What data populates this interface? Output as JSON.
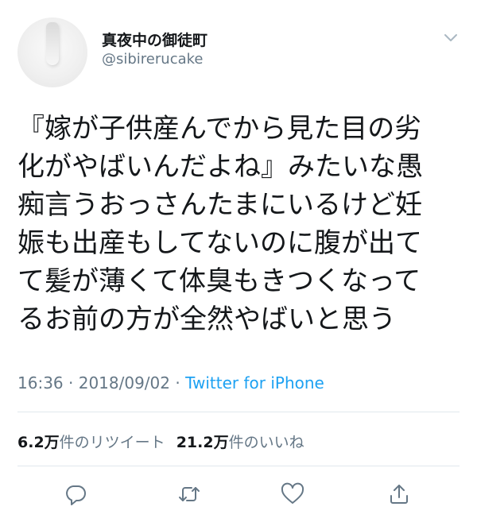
{
  "author": {
    "display_name": "真夜中の御徒町",
    "handle": "@sibirerucake",
    "avatar_icon": "avatar-image"
  },
  "menu_icon": "chevron-down-icon",
  "tweet": {
    "lines": [
      "『嫁が子供産んでから見た目の劣",
      "化がやばいんだよね』みたいな愚",
      "痴言うおっさんたまにいるけど妊",
      "娠も出産もしてないのに腹が出て",
      "て髪が薄くて体臭もきつくなって",
      "るお前の方が全然やばいと思う"
    ]
  },
  "meta": {
    "time": "16:36",
    "separator1": " · ",
    "date": "2018/09/02",
    "separator2": " · ",
    "source": "Twitter for iPhone"
  },
  "stats": {
    "retweets_count": "6.2万",
    "retweets_label": "件のリツイート",
    "likes_count": "21.2万",
    "likes_label": "件のいいね"
  },
  "actions": {
    "reply_icon": "reply-icon",
    "retweet_icon": "retweet-icon",
    "like_icon": "heart-icon",
    "share_icon": "share-icon"
  },
  "colors": {
    "text": "#14171a",
    "secondary": "#657786",
    "link": "#1da1f2",
    "divider": "#e1e8ed"
  }
}
